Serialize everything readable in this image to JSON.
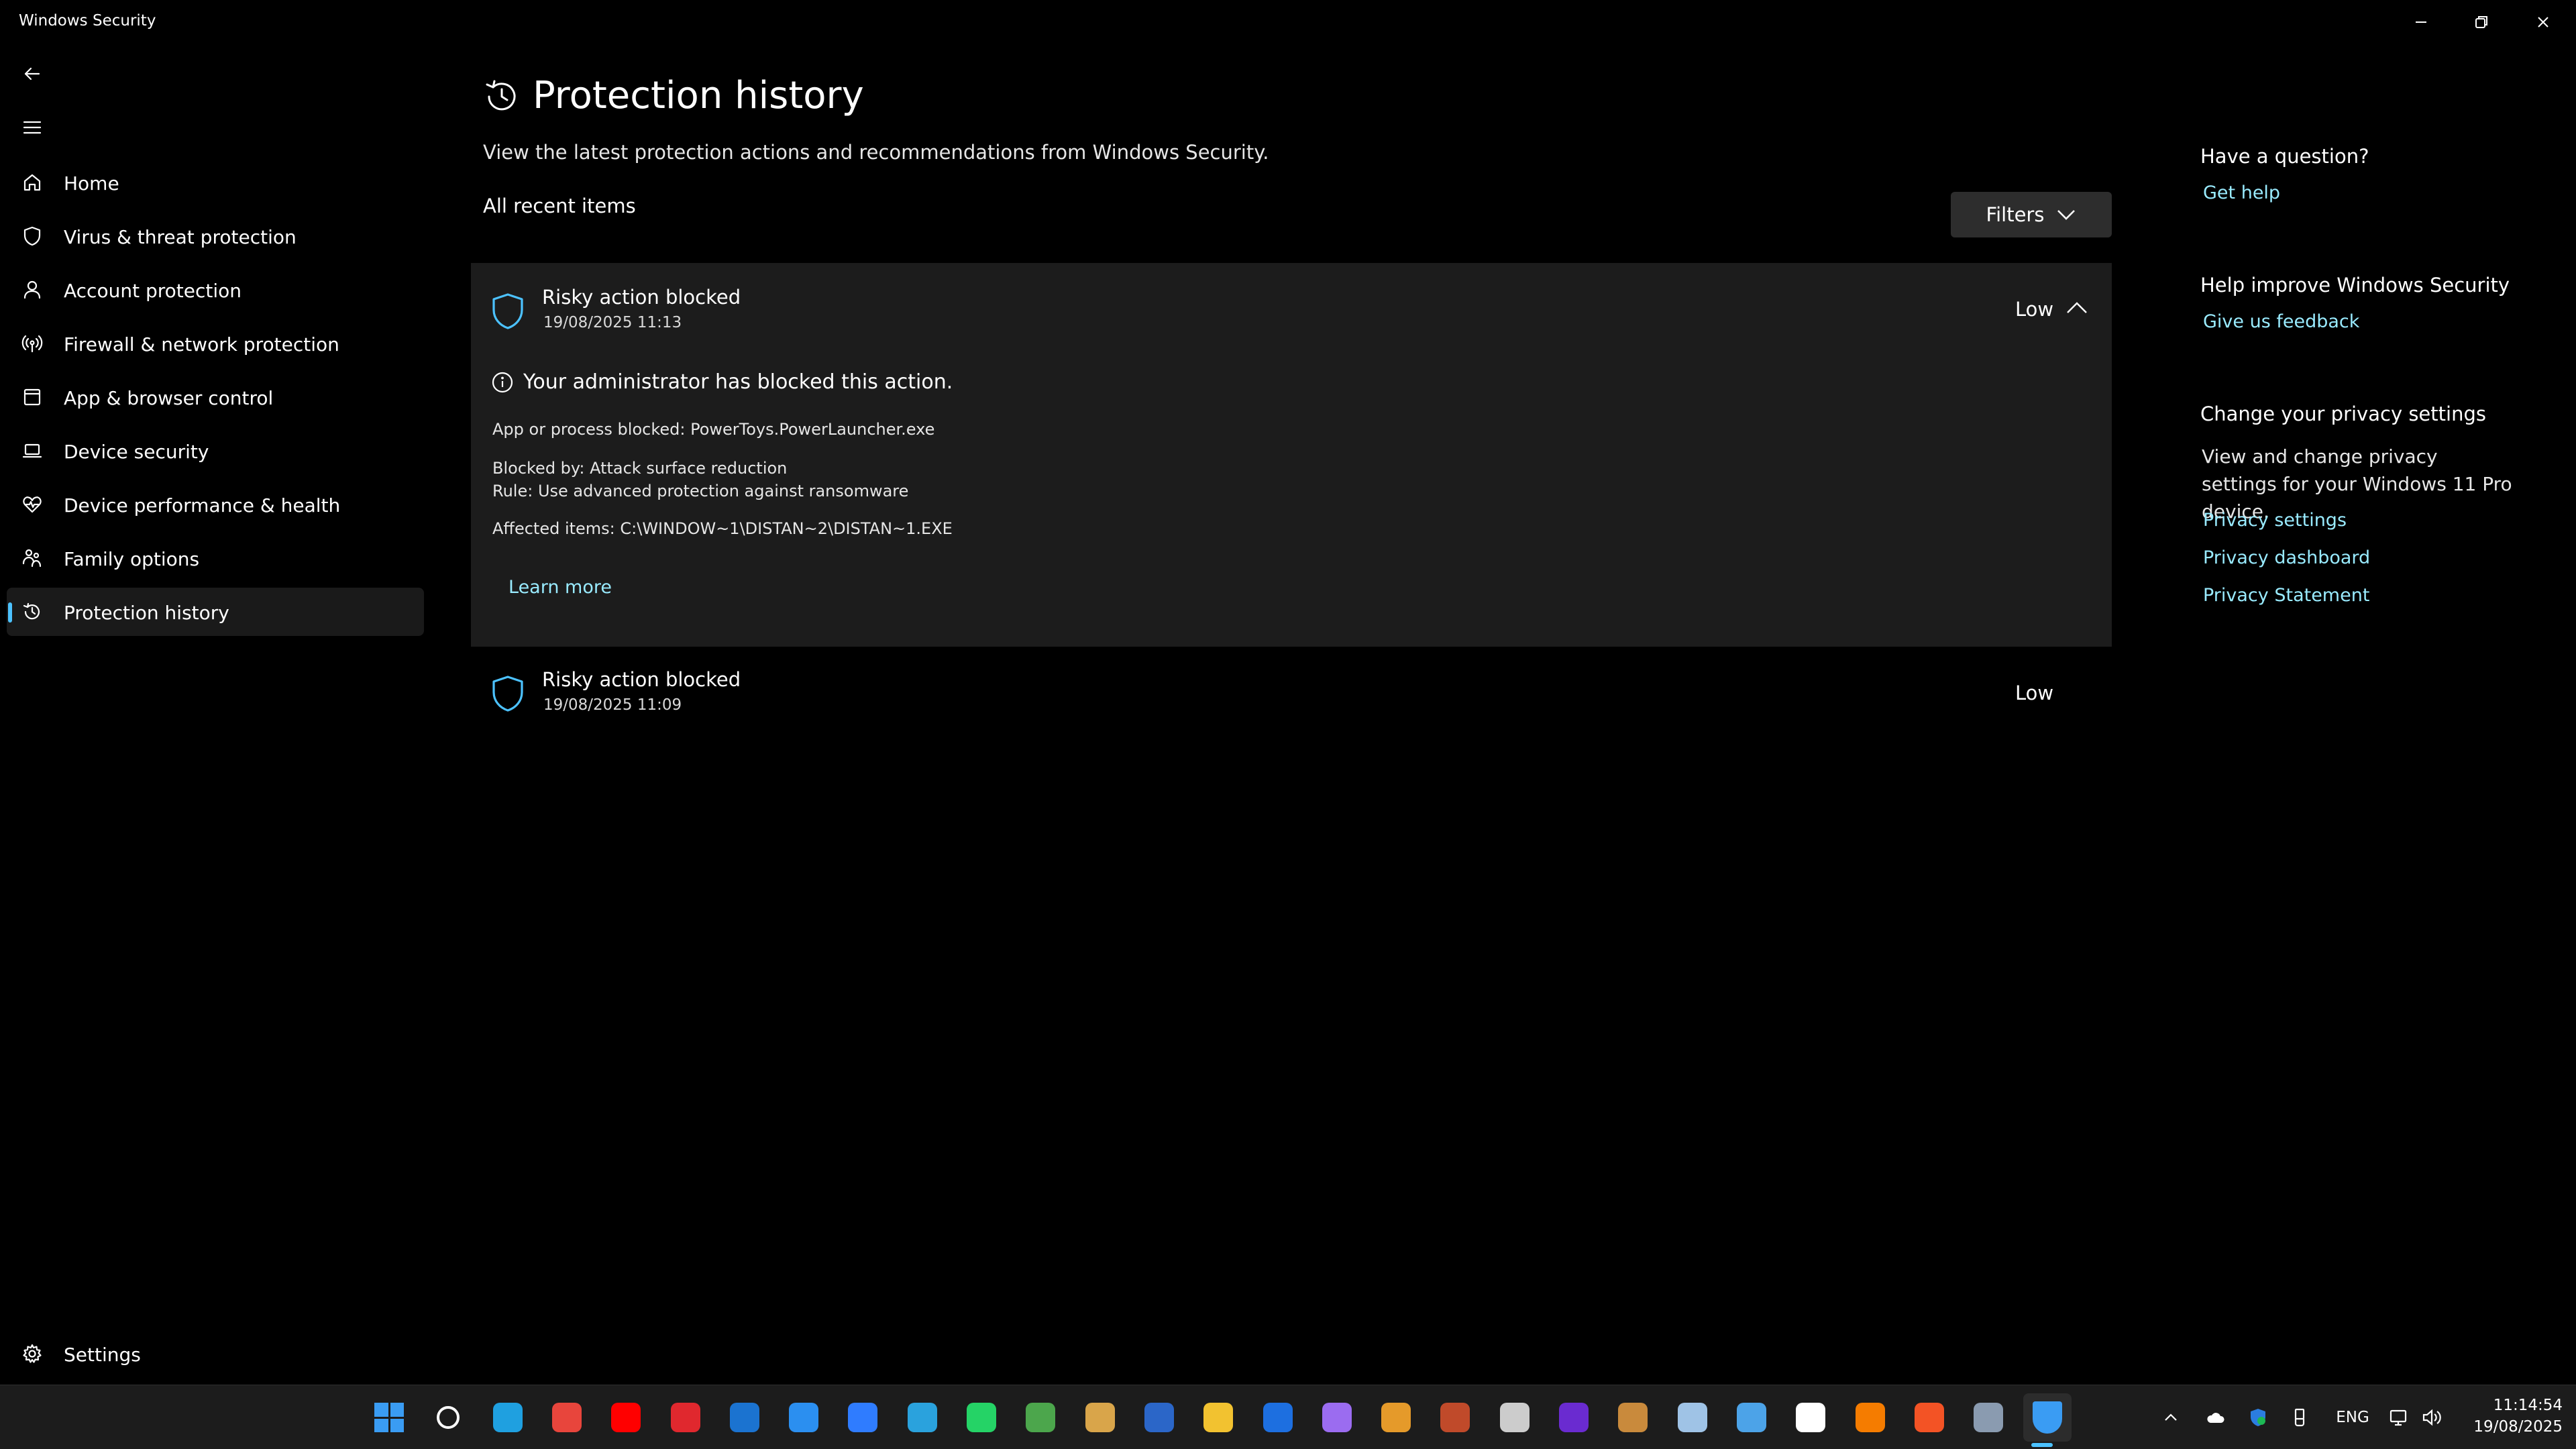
{
  "window": {
    "title": "Windows Security",
    "controls": [
      "minimize-icon",
      "restore-icon",
      "close-icon"
    ]
  },
  "sidebar": {
    "items": [
      {
        "label": "Home",
        "icon": "home-icon"
      },
      {
        "label": "Virus & threat protection",
        "icon": "shield-icon"
      },
      {
        "label": "Account protection",
        "icon": "person-icon"
      },
      {
        "label": "Firewall & network protection",
        "icon": "antenna-icon"
      },
      {
        "label": "App & browser control",
        "icon": "app-window-icon"
      },
      {
        "label": "Device security",
        "icon": "laptop-icon"
      },
      {
        "label": "Device performance & health",
        "icon": "heart-pulse-icon"
      },
      {
        "label": "Family options",
        "icon": "family-icon"
      },
      {
        "label": "Protection history",
        "icon": "history-icon"
      }
    ],
    "active_index": 8,
    "settings_label": "Settings"
  },
  "main": {
    "title": "Protection history",
    "subtitle": "View the latest protection actions and recommendations from Windows Security.",
    "section_label": "All recent items",
    "filters_label": "Filters",
    "items": [
      {
        "title": "Risky action blocked",
        "date": "19/08/2025 11:13",
        "severity": "Low",
        "expanded": true,
        "details": {
          "admin_message": "Your administrator has blocked this action.",
          "app_blocked": "App or process blocked: PowerToys.PowerLauncher.exe",
          "blocked_by": "Blocked by:  Attack surface reduction",
          "rule": "Rule:  Use advanced protection against ransomware",
          "affected": "Affected items:  C:\\WINDOW~1\\DISTAN~2\\DISTAN~1.EXE",
          "learn_more": "Learn more"
        }
      },
      {
        "title": "Risky action blocked",
        "date": "19/08/2025 11:09",
        "severity": "Low",
        "expanded": false
      }
    ]
  },
  "right_column": {
    "question_heading": "Have a question?",
    "get_help": "Get help",
    "improve_heading": "Help improve Windows Security",
    "feedback": "Give us feedback",
    "privacy_heading": "Change your privacy settings",
    "privacy_text": "View and change privacy settings for your Windows 11 Pro device.",
    "privacy_settings": "Privacy settings",
    "privacy_dashboard": "Privacy dashboard",
    "privacy_statement": "Privacy Statement"
  },
  "taskbar": {
    "apps": [
      {
        "name": "start-icon",
        "color": "#3a9cf3"
      },
      {
        "name": "search-icon",
        "color": "#ffffff"
      },
      {
        "name": "edge-icon",
        "color": "#1fa0e0"
      },
      {
        "name": "chrome-icon",
        "color": "#e8453c"
      },
      {
        "name": "youtube-icon",
        "color": "#ff0000"
      },
      {
        "name": "app-red-icon",
        "color": "#e0282e"
      },
      {
        "name": "outlook-icon",
        "color": "#1b73d0"
      },
      {
        "name": "app-blue-a-icon",
        "color": "#2b8ff0"
      },
      {
        "name": "messenger-icon",
        "color": "#2f7cff"
      },
      {
        "name": "telegram-icon",
        "color": "#2aa2dd"
      },
      {
        "name": "whatsapp-icon",
        "color": "#25d366"
      },
      {
        "name": "app-green-icon",
        "color": "#4ca64c"
      },
      {
        "name": "app-folder-icon",
        "color": "#d9a54a"
      },
      {
        "name": "word-icon",
        "color": "#2b66c8"
      },
      {
        "name": "file-explorer-icon",
        "color": "#f2c230"
      },
      {
        "name": "app-blue-square-icon",
        "color": "#1d6fe0"
      },
      {
        "name": "media-player-icon",
        "color": "#9b6cf0"
      },
      {
        "name": "app-check-icon",
        "color": "#e59a2a"
      },
      {
        "name": "app-fruit-icon",
        "color": "#c04a2a"
      },
      {
        "name": "app-film-icon",
        "color": "#cccccc"
      },
      {
        "name": "app-purple-icon",
        "color": "#6a2bd0"
      },
      {
        "name": "app-books-icon",
        "color": "#c98a3c"
      },
      {
        "name": "steam-icon",
        "color": "#9fc3e6"
      },
      {
        "name": "app-remote-icon",
        "color": "#4ca3e8"
      },
      {
        "name": "app-v-icon",
        "color": "#ffffff"
      },
      {
        "name": "app-search-orange-icon",
        "color": "#f57c00"
      },
      {
        "name": "store-icon",
        "color": "#f35325"
      },
      {
        "name": "settings-gear-icon",
        "color": "#8a9bb0"
      },
      {
        "name": "windows-security-icon",
        "color": "#3a9cf3"
      }
    ],
    "active_app": "windows-security-icon",
    "tray_language": "ENG",
    "clock_time": "11:14:54",
    "clock_date": "19/08/2025"
  }
}
